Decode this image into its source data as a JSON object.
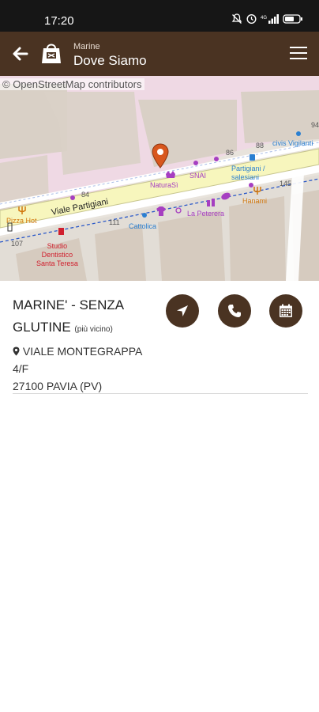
{
  "status_bar": {
    "time": "17:20",
    "icons": [
      "mute-icon",
      "alarm-icon",
      "signal-4g-icon",
      "battery-icon"
    ],
    "battery": "57"
  },
  "app_bar": {
    "subtitle": "Marine",
    "title": "Dove Siamo",
    "icons": [
      "arrow-left-icon",
      "store-logo-icon",
      "hamburger-menu-icon"
    ]
  },
  "map": {
    "attribution": "© OpenStreetMap contributors",
    "labels": {
      "via_main": "Viale Partigiani",
      "pizza": "Pizza Hot",
      "dentist": "Studio\nDentistico\nSanta Teresa",
      "naturasi": "NaturaSì",
      "snai": "SNAI",
      "cattolica": "Cattolica",
      "peterera": "La Peterera",
      "hanami": "Hanami",
      "partigiani_stop": "Partigiani /\nsalesiani",
      "civis": "civis Vigilanti",
      "n84": "84",
      "n86": "86",
      "n88": "88",
      "n94": "94",
      "n145": "145",
      "n111": "111",
      "n107": "107"
    },
    "colors": {
      "road": "#f7f6bd",
      "poi": "#a63fc1",
      "food": "#d1770d",
      "health": "#d0202e",
      "transit": "#2a7fd1",
      "marker": "#d8571e"
    }
  },
  "store": {
    "name": "MARINE' - SENZA GLUTINE",
    "note": "(più vicino)",
    "address_line1": "VIALE MONTEGRAPPA",
    "address_line2": "4/F",
    "address_line3": "27100 PAVIA (PV)"
  },
  "actions": {
    "icons": [
      "navigate-arrow-icon",
      "phone-icon",
      "calendar-icon"
    ]
  },
  "theme": {
    "brand": "#4a3322"
  }
}
